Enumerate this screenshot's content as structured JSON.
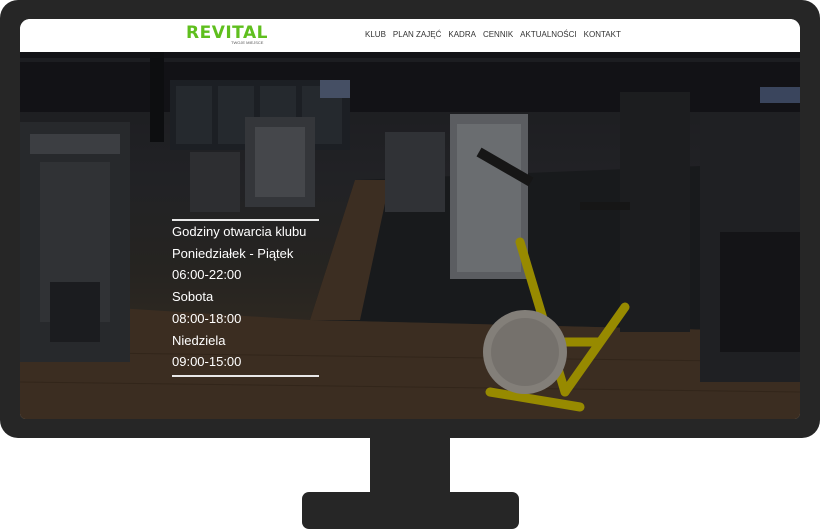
{
  "brand": {
    "logo_text": "REVITAL",
    "tagline": "TWOJE MIEJSCE",
    "accent_color": "#5fbf1e"
  },
  "nav": {
    "items": [
      {
        "label": "KLUB"
      },
      {
        "label": "PLAN ZAJĘĆ"
      },
      {
        "label": "KADRA"
      },
      {
        "label": "CENNIK"
      },
      {
        "label": "AKTUALNOŚCI"
      },
      {
        "label": "KONTAKT"
      }
    ]
  },
  "hours": {
    "title": "Godziny otwarcia klubu",
    "weekdays_label": "Poniedziałek - Piątek",
    "weekdays_hours": "06:00-22:00",
    "saturday_label": "Sobota",
    "saturday_hours": "08:00-18:00",
    "sunday_label": "Niedziela",
    "sunday_hours": "09:00-15:00"
  },
  "hero": {
    "image": "gym-interior-photo"
  }
}
